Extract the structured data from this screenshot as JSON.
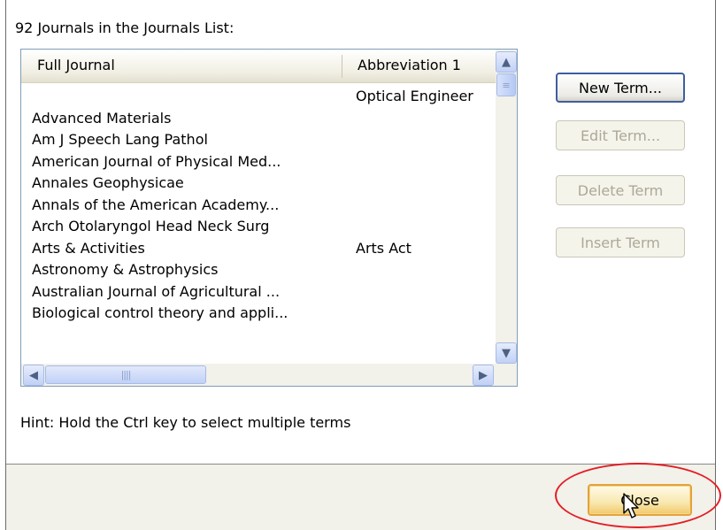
{
  "dialog": {
    "count_label": "92 Journals in the Journals List:",
    "list": {
      "columns": [
        "Full Journal",
        "Abbreviation 1"
      ],
      "rows": [
        {
          "full": "",
          "abbr": "Optical Engineer"
        },
        {
          "full": "Advanced Materials",
          "abbr": ""
        },
        {
          "full": "Am J Speech Lang Pathol",
          "abbr": ""
        },
        {
          "full": "American Journal of Physical Med...",
          "abbr": ""
        },
        {
          "full": "Annales Geophysicae",
          "abbr": ""
        },
        {
          "full": "Annals of the American Academy...",
          "abbr": ""
        },
        {
          "full": "Arch Otolaryngol Head Neck Surg",
          "abbr": ""
        },
        {
          "full": "Arts & Activities",
          "abbr": "Arts Act"
        },
        {
          "full": "Astronomy & Astrophysics",
          "abbr": ""
        },
        {
          "full": "Australian Journal of Agricultural ...",
          "abbr": ""
        },
        {
          "full": "Biological control theory and appli...",
          "abbr": ""
        }
      ]
    },
    "buttons": {
      "new_term": "New Term...",
      "edit_term": "Edit Term...",
      "delete_term": "Delete Term",
      "insert_term": "Insert Term"
    },
    "hint": "Hint: Hold the Ctrl key to select multiple terms",
    "close": "Close"
  },
  "icons": {
    "scroll_up": "scroll-up-arrow-icon",
    "scroll_down": "scroll-down-arrow-icon",
    "scroll_left": "scroll-left-arrow-icon",
    "scroll_right": "scroll-right-arrow-icon",
    "cursor": "mouse-pointer-icon"
  },
  "colors": {
    "list_border": "#7f9db9",
    "scroll_button": "#c1d1f6",
    "close_highlight_ring": "#e31d24",
    "close_button_focus": "#e5a23a"
  }
}
